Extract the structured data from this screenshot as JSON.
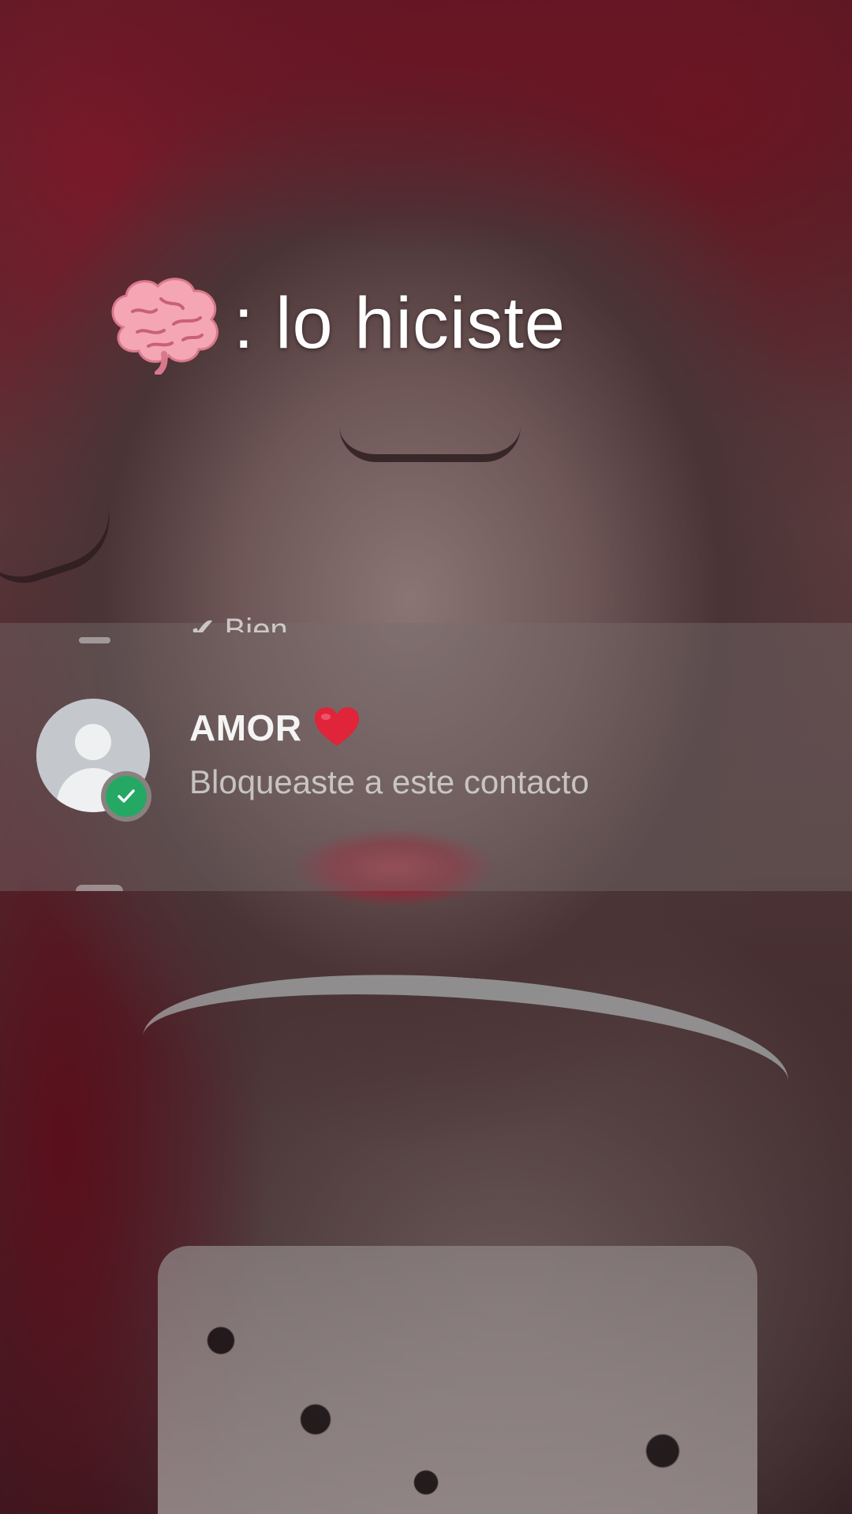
{
  "overlay": {
    "caption_text": ": lo hiciste",
    "caption_emoji": "brain-icon"
  },
  "chat_list": {
    "previous_row_snippet": "✔ Bien",
    "contact": {
      "name": "AMOR",
      "name_emoji": "heart-icon",
      "status": "Bloqueaste a este contacto",
      "avatar": "default-user-avatar",
      "avatar_badge": "check-badge-icon"
    }
  },
  "colors": {
    "badge_green": "#25a863",
    "heart_red": "#e0243a",
    "brain_pink": "#f4a6b4",
    "panel_overlay": "rgba(120,110,110,0.42)"
  }
}
